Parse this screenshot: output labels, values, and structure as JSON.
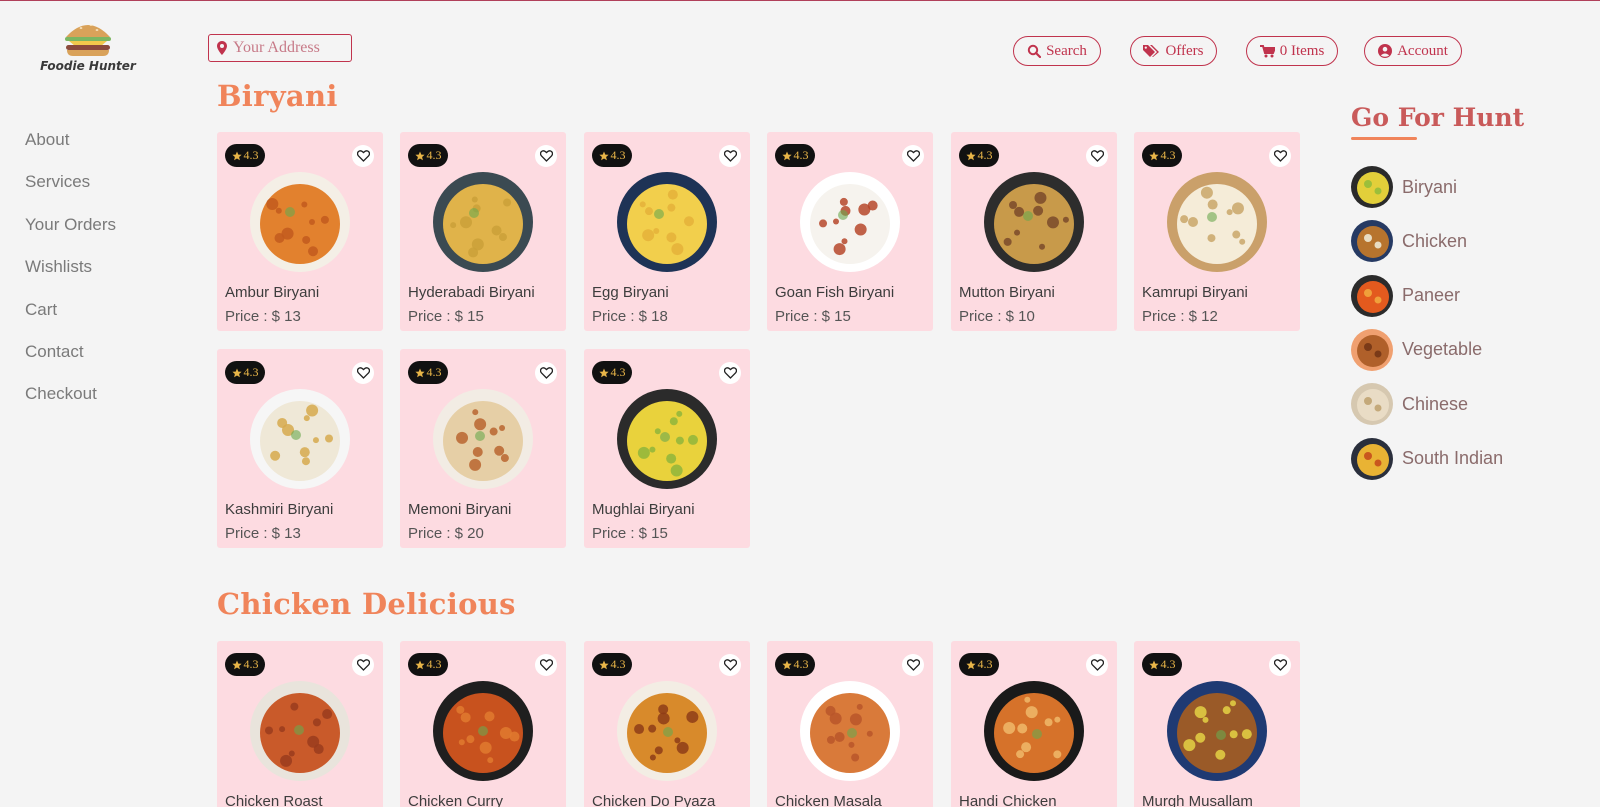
{
  "brand": {
    "name": "Foodie Hunter"
  },
  "address": {
    "placeholder": "Your Address"
  },
  "nav": {
    "search": "Search",
    "offers": "Offers",
    "cart": "0 Items",
    "account": "Account"
  },
  "sidebar": {
    "items": [
      {
        "label": "About"
      },
      {
        "label": "Services"
      },
      {
        "label": "Your Orders"
      },
      {
        "label": "Wishlists"
      },
      {
        "label": "Cart"
      },
      {
        "label": "Contact"
      },
      {
        "label": "Checkout"
      }
    ]
  },
  "sections": [
    {
      "title": "Biryani",
      "items": [
        {
          "name": "Ambur Biryani",
          "price": "Price : $ 13",
          "rating": "4.3"
        },
        {
          "name": "Hyderabadi Biryani",
          "price": "Price : $ 15",
          "rating": "4.3"
        },
        {
          "name": "Egg Biryani",
          "price": "Price : $ 18",
          "rating": "4.3"
        },
        {
          "name": "Goan Fish Biryani",
          "price": "Price : $ 15",
          "rating": "4.3"
        },
        {
          "name": "Mutton Biryani",
          "price": "Price : $ 10",
          "rating": "4.3"
        },
        {
          "name": "Kamrupi Biryani",
          "price": "Price : $ 12",
          "rating": "4.3"
        },
        {
          "name": "Kashmiri Biryani",
          "price": "Price : $ 13",
          "rating": "4.3"
        },
        {
          "name": "Memoni Biryani",
          "price": "Price : $ 20",
          "rating": "4.3"
        },
        {
          "name": "Mughlai Biryani",
          "price": "Price : $ 15",
          "rating": "4.3"
        }
      ]
    },
    {
      "title": "Chicken Delicious",
      "items": [
        {
          "name": "Chicken Roast",
          "rating": "4.3"
        },
        {
          "name": "Chicken Curry",
          "rating": "4.3"
        },
        {
          "name": "Chicken Do Pyaza",
          "rating": "4.3"
        },
        {
          "name": "Chicken Masala",
          "rating": "4.3"
        },
        {
          "name": "Handi Chicken",
          "rating": "4.3"
        },
        {
          "name": "Murgh Musallam",
          "rating": "4.3"
        }
      ]
    }
  ],
  "hunt": {
    "title": "Go For Hunt",
    "items": [
      {
        "label": "Biryani"
      },
      {
        "label": "Chicken"
      },
      {
        "label": "Paneer"
      },
      {
        "label": "Vegetable"
      },
      {
        "label": "Chinese"
      },
      {
        "label": "South Indian"
      }
    ]
  },
  "colors": {
    "accent": "#c0334d",
    "heading": "#f0845a",
    "card": "#fddbe1",
    "rating_star": "#e8b548"
  }
}
